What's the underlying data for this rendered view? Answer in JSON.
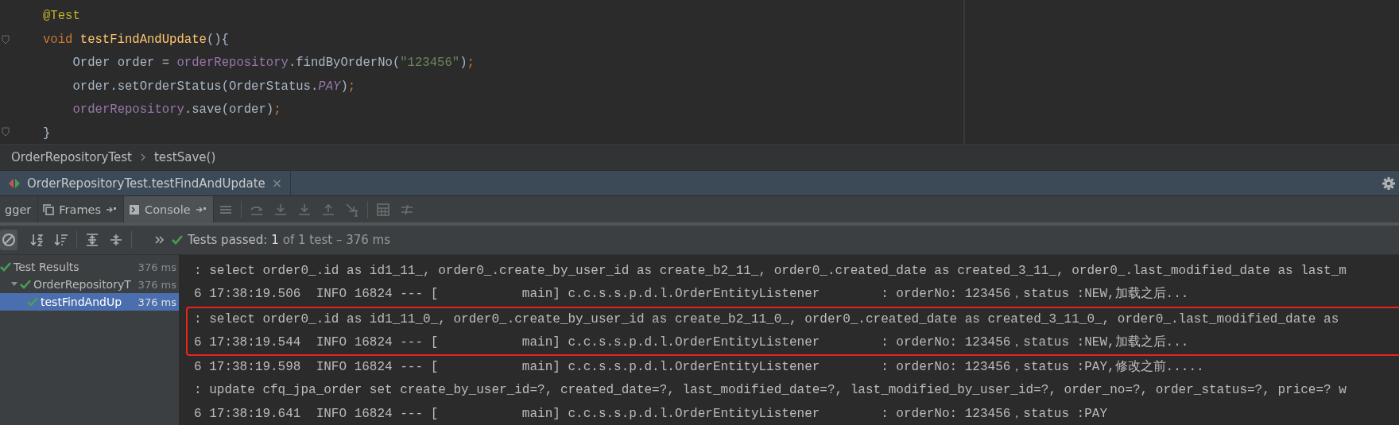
{
  "editor": {
    "lines": [
      {
        "indented": false,
        "tokens": [
          {
            "text": "@Test",
            "kind": "annotation"
          }
        ]
      },
      {
        "indented": false,
        "tokens": [
          {
            "text": "void",
            "kind": "keyword"
          },
          {
            "text": " testFindAndUpdate",
            "kind": "method"
          },
          {
            "text": "(){",
            "kind": "plain"
          }
        ]
      },
      {
        "indented": true,
        "tokens": [
          {
            "text": "Order order = ",
            "kind": "plain"
          },
          {
            "text": "orderRepository",
            "kind": "field"
          },
          {
            "text": ".findByOrderNo(",
            "kind": "plain"
          },
          {
            "text": "\"123456\"",
            "kind": "string"
          },
          {
            "text": ")",
            "kind": "plain"
          },
          {
            "text": ";",
            "kind": "keyword"
          }
        ]
      },
      {
        "indented": true,
        "tokens": [
          {
            "text": "order.setOrderStatus(OrderStatus.",
            "kind": "plain"
          },
          {
            "text": "PAY",
            "kind": "constant"
          },
          {
            "text": ")",
            "kind": "plain"
          },
          {
            "text": ";",
            "kind": "keyword"
          }
        ]
      },
      {
        "indented": true,
        "tokens": [
          {
            "text": "orderRepository",
            "kind": "field"
          },
          {
            "text": ".save(order)",
            "kind": "plain"
          },
          {
            "text": ";",
            "kind": "keyword"
          }
        ]
      },
      {
        "indented": false,
        "tokens": [
          {
            "text": "}",
            "kind": "plain"
          }
        ]
      }
    ]
  },
  "breadcrumb": [
    "OrderRepositoryTest",
    "testSave()"
  ],
  "run_tab": {
    "label": "OrderRepositoryTest.testFindAndUpdate",
    "close": "×"
  },
  "debug_tabs": [
    {
      "label": "gger",
      "selected": false,
      "pinned": false
    },
    {
      "label": "Frames",
      "selected": false,
      "pinned": true
    },
    {
      "label": "Console",
      "selected": true,
      "pinned": true
    }
  ],
  "test_status": {
    "label": "Tests passed:",
    "count": "1",
    "detail": "of 1 test – 376 ms"
  },
  "test_tree": [
    {
      "label": "Test Results",
      "time": "376 ms",
      "passed": true,
      "selected": false,
      "children": [
        {
          "label": "OrderRepositoryT",
          "time": "376 ms",
          "passed": true,
          "selected": false,
          "children": [
            {
              "label": "testFindAndUp",
              "time": "376 ms",
              "passed": true,
              "selected": true
            }
          ]
        }
      ]
    }
  ],
  "console": [
    {
      "text": ": select order0_.id as id1_11_, order0_.create_by_user_id as create_b2_11_, order0_.created_date as created_3_11_, order0_.last_modified_date as last_m",
      "highlighted": false
    },
    {
      "text": "6 17:38:19.506  INFO 16824 --- [           main] c.c.s.s.p.d.l.OrderEntityListener        : orderNo: 123456，status :NEW,加载之后...",
      "highlighted": false
    },
    {
      "text": ": select order0_.id as id1_11_0_, order0_.create_by_user_id as create_b2_11_0_, order0_.created_date as created_3_11_0_, order0_.last_modified_date as",
      "highlighted": true
    },
    {
      "text": "6 17:38:19.544  INFO 16824 --- [           main] c.c.s.s.p.d.l.OrderEntityListener        : orderNo: 123456，status :NEW,加载之后...",
      "highlighted": true
    },
    {
      "text": "6 17:38:19.598  INFO 16824 --- [           main] c.c.s.s.p.d.l.OrderEntityListener        : orderNo: 123456，status :PAY,修改之前.....",
      "highlighted": false
    },
    {
      "text": ": update cfq_jpa_order set create_by_user_id=?, created_date=?, last_modified_date=?, last_modified_by_user_id=?, order_no=?, order_status=?, price=? w",
      "highlighted": false
    },
    {
      "text": "6 17:38:19.641  INFO 16824 --- [           main] c.c.s.s.p.d.l.OrderEntityListener        : orderNo: 123456，status :PAY",
      "highlighted": false
    }
  ]
}
